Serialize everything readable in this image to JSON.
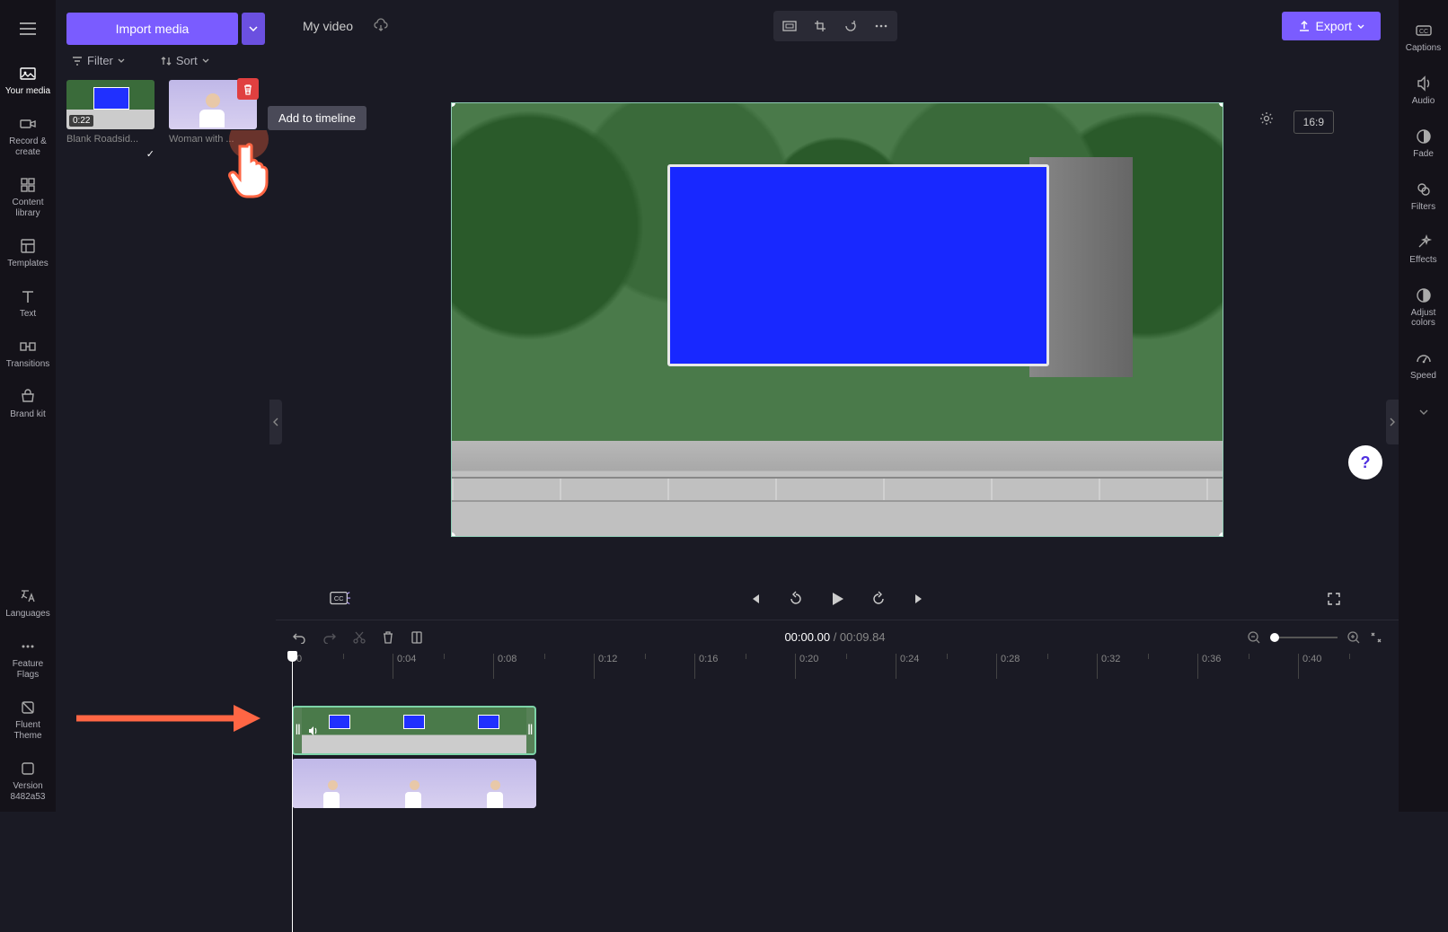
{
  "left_rail": {
    "items": [
      {
        "label": "Your media"
      },
      {
        "label": "Record & create"
      },
      {
        "label": "Content library"
      },
      {
        "label": "Templates"
      },
      {
        "label": "Text"
      },
      {
        "label": "Transitions"
      },
      {
        "label": "Brand kit"
      }
    ],
    "bottom_items": [
      {
        "label": "Languages"
      },
      {
        "label": "Feature Flags"
      },
      {
        "label": "Fluent Theme"
      },
      {
        "label": "Version 8482a53"
      }
    ]
  },
  "media_panel": {
    "import_label": "Import media",
    "filter_label": "Filter",
    "sort_label": "Sort",
    "clips": [
      {
        "name": "Blank Roadsid...",
        "duration": "0:22"
      },
      {
        "name": "Woman with ..."
      }
    ]
  },
  "tooltip": "Add to timeline",
  "top_bar": {
    "project_title": "My video",
    "export_label": "Export",
    "aspect": "16:9"
  },
  "playback": {
    "cc_label": "CC"
  },
  "timeline": {
    "current_time": "00:00.00",
    "total_time": "00:09.84",
    "ruler_marks": [
      "0",
      "0:04",
      "0:08",
      "0:12",
      "0:16",
      "0:20",
      "0:24",
      "0:28",
      "0:32",
      "0:36",
      "0:40"
    ]
  },
  "right_rail": {
    "items": [
      {
        "label": "Captions"
      },
      {
        "label": "Audio"
      },
      {
        "label": "Fade"
      },
      {
        "label": "Filters"
      },
      {
        "label": "Effects"
      },
      {
        "label": "Adjust colors"
      },
      {
        "label": "Speed"
      }
    ]
  },
  "help": "?"
}
